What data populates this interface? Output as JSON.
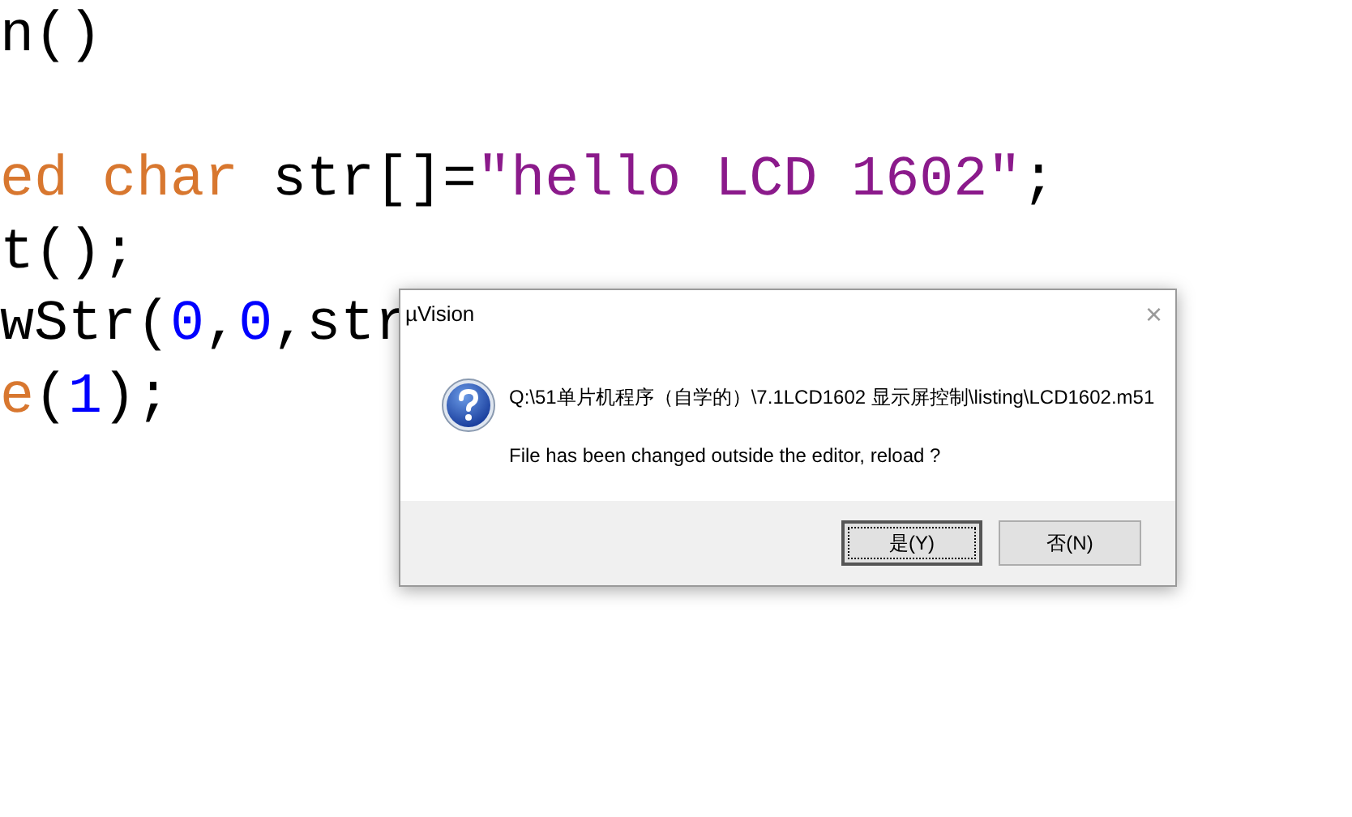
{
  "editor": {
    "lines": [
      [
        {
          "kind": "plain",
          "text": "n()"
        }
      ],
      [
        {
          "kind": "blank"
        }
      ],
      [
        {
          "kind": "keyword",
          "text": "ed char"
        },
        {
          "kind": "plain",
          "text": " str[]="
        },
        {
          "kind": "string",
          "text": "\"hello LCD 1602\""
        },
        {
          "kind": "plain",
          "text": ";"
        }
      ],
      [
        {
          "kind": "plain",
          "text": "t();"
        }
      ],
      [
        {
          "kind": "plain",
          "text": "wStr("
        },
        {
          "kind": "number",
          "text": "0"
        },
        {
          "kind": "plain",
          "text": ","
        },
        {
          "kind": "number",
          "text": "0"
        },
        {
          "kind": "plain",
          "text": ",str"
        }
      ],
      [
        {
          "kind": "keyword",
          "text": "e"
        },
        {
          "kind": "plain",
          "text": "("
        },
        {
          "kind": "number",
          "text": "1"
        },
        {
          "kind": "plain",
          "text": ");"
        }
      ]
    ]
  },
  "dialog": {
    "title": "µVision",
    "close": "×",
    "path": "Q:\\51单片机程序（自学的）\\7.1LCD1602 显示屏控制\\listing\\LCD1602.m51",
    "message": "File has been changed outside the editor, reload ?",
    "buttons": [
      {
        "label": "是(Y)",
        "selected": true
      },
      {
        "label": "否(N)",
        "selected": false
      }
    ]
  }
}
